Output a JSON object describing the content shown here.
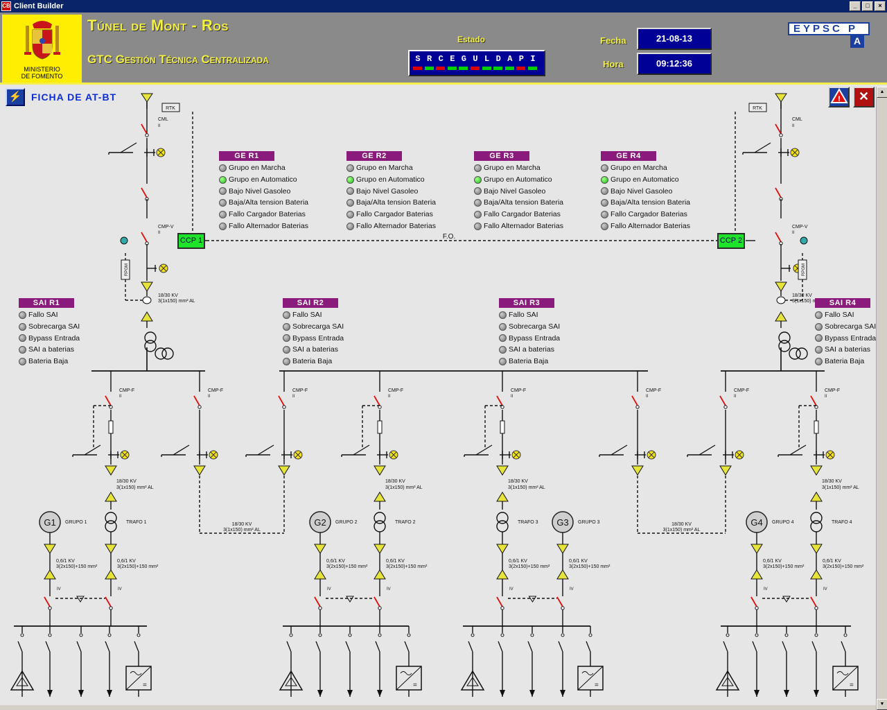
{
  "window": {
    "title": "Client Builder",
    "app_icon": "CB",
    "controls": [
      "minimize",
      "maximize",
      "close"
    ]
  },
  "header": {
    "ministry": [
      "MINISTERIO",
      "DE FOMENTO"
    ],
    "title": "Túnel de Mont - Ros",
    "subtitle": "GTC Gestión Técnica Centralizada",
    "estado_label": "Estado",
    "estado_letters": [
      "S",
      "R",
      "C",
      "E",
      "G",
      "U",
      "L",
      "D",
      "A",
      "P",
      "I"
    ],
    "estado_colors": [
      "#e00000",
      "#00d000",
      "#e00000",
      "#00d000",
      "#00d000",
      "#e00000",
      "#00d000",
      "#00d000",
      "#00d000",
      "#e00000",
      "#00d000"
    ],
    "fecha_label": "Fecha",
    "fecha_value": "21-08-13",
    "hora_label": "Hora",
    "hora_value": "09:12:36",
    "company_a": "EYPSC P",
    "company_b": "A"
  },
  "toolbar": {
    "ficha_label": "FICHA DE AT-BT",
    "alarm_icon": "warning-icon",
    "close_icon": "close-icon"
  },
  "generators": [
    {
      "title": "GE R1",
      "items": [
        {
          "label": "Grupo en Marcha",
          "state": "off"
        },
        {
          "label": "Grupo en Automatico",
          "state": "on"
        },
        {
          "label": "Bajo Nivel Gasoleo",
          "state": "off"
        },
        {
          "label": "Baja/Alta tension Bateria",
          "state": "off"
        },
        {
          "label": "Fallo Cargador Baterias",
          "state": "off"
        },
        {
          "label": "Fallo Alternador Baterias",
          "state": "off"
        }
      ]
    },
    {
      "title": "GE R2",
      "items": [
        {
          "label": "Grupo en Marcha",
          "state": "off"
        },
        {
          "label": "Grupo en Automatico",
          "state": "on"
        },
        {
          "label": "Bajo Nivel Gasoleo",
          "state": "off"
        },
        {
          "label": "Baja/Alta tension Bateria",
          "state": "off"
        },
        {
          "label": "Fallo Cargador Baterias",
          "state": "off"
        },
        {
          "label": "Fallo Alternador Baterias",
          "state": "off"
        }
      ]
    },
    {
      "title": "GE R3",
      "items": [
        {
          "label": "Grupo en Marcha",
          "state": "off"
        },
        {
          "label": "Grupo en Automatico",
          "state": "on"
        },
        {
          "label": "Bajo Nivel Gasoleo",
          "state": "off"
        },
        {
          "label": "Baja/Alta tension Bateria",
          "state": "off"
        },
        {
          "label": "Fallo Cargador Baterias",
          "state": "off"
        },
        {
          "label": "Fallo Alternador Baterias",
          "state": "off"
        }
      ]
    },
    {
      "title": "GE R4",
      "items": [
        {
          "label": "Grupo en Marcha",
          "state": "off"
        },
        {
          "label": "Grupo en Automatico",
          "state": "on"
        },
        {
          "label": "Bajo Nivel Gasoleo",
          "state": "off"
        },
        {
          "label": "Baja/Alta tension Bateria",
          "state": "off"
        },
        {
          "label": "Fallo Cargador Baterias",
          "state": "off"
        },
        {
          "label": "Fallo Alternador Baterias",
          "state": "off"
        }
      ]
    }
  ],
  "sais": [
    {
      "title": "SAI R1",
      "items": [
        {
          "label": "Fallo SAI",
          "state": "off"
        },
        {
          "label": "Sobrecarga SAI",
          "state": "off"
        },
        {
          "label": "Bypass Entrada",
          "state": "off"
        },
        {
          "label": "SAI a baterias",
          "state": "off"
        },
        {
          "label": "Bateria Baja",
          "state": "off"
        }
      ]
    },
    {
      "title": "SAI R2",
      "items": [
        {
          "label": "Fallo SAI",
          "state": "off"
        },
        {
          "label": "Sobrecarga SAI",
          "state": "off"
        },
        {
          "label": "Bypass Entrada",
          "state": "off"
        },
        {
          "label": "SAI a baterias",
          "state": "off"
        },
        {
          "label": "Bateria Baja",
          "state": "off"
        }
      ]
    },
    {
      "title": "SAI R3",
      "items": [
        {
          "label": "Fallo SAI",
          "state": "off"
        },
        {
          "label": "Sobrecarga SAI",
          "state": "off"
        },
        {
          "label": "Bypass Entrada",
          "state": "off"
        },
        {
          "label": "SAI a baterias",
          "state": "off"
        },
        {
          "label": "Bateria Baja",
          "state": "off"
        }
      ]
    },
    {
      "title": "SAI R4",
      "items": [
        {
          "label": "Fallo SAI",
          "state": "off"
        },
        {
          "label": "Sobrecarga SAI",
          "state": "off"
        },
        {
          "label": "Bypass Entrada",
          "state": "off"
        },
        {
          "label": "SAI a baterias",
          "state": "off"
        },
        {
          "label": "Bateria Baja",
          "state": "off"
        }
      ]
    }
  ],
  "diagram": {
    "ccp1": "CCP 1",
    "ccp2": "CCP 2",
    "fo": "F.O.",
    "rtk": "RTK",
    "rpgm": "RPGM",
    "cml": "CML",
    "cmpv": "CMP-V",
    "cmpf": "CMP-F",
    "roman2": "II",
    "roman4": "IV",
    "mv_cable": "18/30 KV",
    "mv_section": "3(1x150) mm² AL",
    "lv_cable": "0,6/1 KV",
    "lv_section": "3(2x150)+150 mm²",
    "gens": [
      "G1",
      "G2",
      "G3",
      "G4"
    ],
    "grupos": [
      "GRUPO 1",
      "GRUPO 2",
      "GRUPO 3",
      "GRUPO 4"
    ],
    "trafos": [
      "TRAFO 1",
      "TRAFO 2",
      "TRAFO 3",
      "TRAFO 4"
    ],
    "colors": {
      "breaker": "#e01010",
      "lamp": "#f4e21a",
      "arrow": "#e6e43a"
    }
  }
}
